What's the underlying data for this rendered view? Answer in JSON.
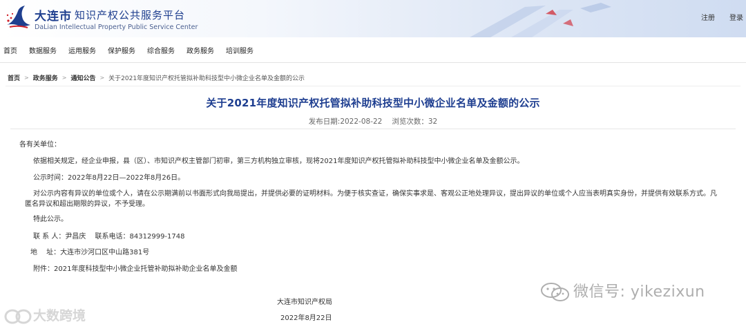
{
  "header": {
    "brand_cn": "大连市",
    "title_cn": "知识产权公共服务平台",
    "title_en": "DaLian Intellectual Property Public Service Center",
    "register": "注册",
    "login": "登录"
  },
  "nav": [
    "首页",
    "数据服务",
    "运用服务",
    "保护服务",
    "综合服务",
    "政务服务",
    "培训服务"
  ],
  "breadcrumb": {
    "items": [
      "首页",
      "政务服务",
      "通知公告"
    ],
    "current": "关于2021年度知识产权托管拟补助科技型中小微企业名单及金额的公示"
  },
  "article": {
    "title": "关于2021年度知识产权托管拟补助科技型中小微企业名单及金额的公示",
    "publish_date": "发布日期:2022-08-22",
    "views": "浏览次数：32",
    "salutation": "各有关单位：",
    "para1": "依据相关规定，经企业申报，县（区）、市知识产权主管部门初审，第三方机构独立审核，现将2021年度知识产权托管拟补助科技型中小微企业名单及金额公示。",
    "para2": "公示时间：2022年8月22日—2022年8月26日。",
    "para3_line1": "对公示内容有异议的单位或个人，请在公示期满前以书面形式向我局提出，并提供必要的证明材料。为便于核实查证，确保实事求是、客观公正地处理异议，提出异议的单位或个人应当表明真实身份，并提供有效联系方式。凡",
    "para3_line2": "匿名异议和超出期限的异议，不予受理。",
    "para4": "特此公示。",
    "contact": "联 系 人：尹昌庆　 联系电话：84312999-1748",
    "address_label": "地　 址：大连市沙河口区中山路381号",
    "attachment": "附件：2021年度科技型中小微企业托管补助拟补助企业名单及金额",
    "signature": "大连市知识产权局",
    "sign_date": "2022年8月22日"
  },
  "watermark": {
    "right": "微信号: yikezixun",
    "left": "大数跨境"
  },
  "colors": {
    "title": "#1e3e90",
    "brand": "#1f3f8f",
    "logo_red": "#d0202a"
  }
}
